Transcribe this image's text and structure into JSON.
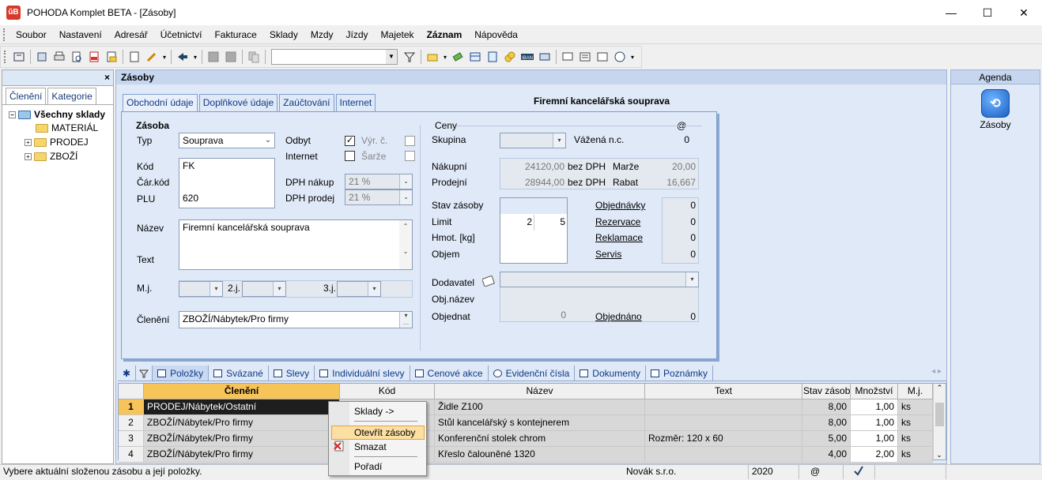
{
  "window": {
    "title": "POHODA Komplet BETA - [Zásoby]",
    "app_icon": "ŭB",
    "minimize": "—",
    "maximize": "☐",
    "close": "✕"
  },
  "menu": [
    "Soubor",
    "Nastavení",
    "Adresář",
    "Účetnictví",
    "Fakturace",
    "Sklady",
    "Mzdy",
    "Jízdy",
    "Majetek",
    "Záznam",
    "Nápověda"
  ],
  "left": {
    "close": "×",
    "tabs": [
      "Členění",
      "Kategorie"
    ],
    "tree": {
      "root": "Všechny sklady",
      "items": [
        "MATERIÁL",
        "PRODEJ",
        "ZBOŽÍ"
      ],
      "expand": "+",
      "collapse": "−"
    }
  },
  "main": {
    "title": "Zásoby",
    "tabs": [
      "Obchodní údaje",
      "Doplňkové údaje",
      "Zaúčtování",
      "Internet"
    ],
    "record_title": "Firemní kancelářská souprava"
  },
  "zasoba": {
    "title": "Zásoba",
    "typ_label": "Typ",
    "typ_value": "Souprava",
    "odbyt_label": "Odbyt",
    "internet_label": "Internet",
    "vyr_c_label": "Výr. č.",
    "sarze_label": "Šarže",
    "kod_label": "Kód",
    "kod_value": "FK",
    "car_kod_label": "Čár.kód",
    "plu_label": "PLU",
    "plu_value": "620",
    "dph_nakup_label": "DPH nákup",
    "dph_nakup_value": "21 %",
    "dph_prodej_label": "DPH prodej",
    "dph_prodej_value": "21 %",
    "nazev_label": "Název",
    "nazev_value": "Firemní kancelářská souprava",
    "text_label": "Text",
    "mj_label": "M.j.",
    "j2_label": "2.j.",
    "j3_label": "3.j.",
    "cleneni_label": "Členění",
    "cleneni_value": "ZBOŽÍ/Nábytek/Pro firmy"
  },
  "ceny": {
    "title": "Ceny",
    "at": "@",
    "skupina_label": "Skupina",
    "vazena_label": "Vážená n.c.",
    "vazena_value": "0",
    "nakupni_label": "Nákupní",
    "nakupni_value": "24120,00",
    "nakupni_unit": "bez DPH",
    "marze_label": "Marže",
    "marze_value": "20,00",
    "prodejni_label": "Prodejní",
    "prodejni_value": "28944,00",
    "prodejni_unit": "bez DPH",
    "rabat_label": "Rabat",
    "rabat_value": "16,667",
    "stav_label": "Stav zásoby",
    "limit_label": "Limit",
    "limit_min": "2",
    "limit_max": "5",
    "hmot_label": "Hmot. [kg]",
    "objem_label": "Objem",
    "objednavky": "Objednávky",
    "objednavky_val": "0",
    "rezervace": "Rezervace",
    "rezervace_val": "0",
    "reklamace": "Reklamace",
    "reklamace_val": "0",
    "servis": "Servis",
    "servis_val": "0",
    "dodavatel_label": "Dodavatel",
    "objnazev_label": "Obj.název",
    "objednat_label": "Objednat",
    "objednat_value": "0",
    "objednano": "Objednáno",
    "objednano_val": "0"
  },
  "bottom_tabs": {
    "star": "✱",
    "items": [
      "Položky",
      "Svázané",
      "Slevy",
      "Individuální slevy",
      "Cenové akce",
      "Evidenční čísla",
      "Dokumenty",
      "Poznámky"
    ]
  },
  "grid": {
    "headers": [
      "Členění",
      "Kód",
      "Název",
      "Text",
      "Stav zásoby",
      "Množství",
      "M.j."
    ],
    "rows": [
      {
        "n": "1",
        "cleneni": "PRODEJ/Nábytek/Ostatní",
        "kod": "",
        "nazev": "Židle Z100",
        "text": "",
        "stav": "8,00",
        "mnozstvi": "1,00",
        "mj": "ks"
      },
      {
        "n": "2",
        "cleneni": "ZBOŽÍ/Nábytek/Pro firmy",
        "kod": "",
        "nazev": "Stůl kancelářský s kontejnerem",
        "text": "",
        "stav": "8,00",
        "mnozstvi": "1,00",
        "mj": "ks"
      },
      {
        "n": "3",
        "cleneni": "ZBOŽÍ/Nábytek/Pro firmy",
        "kod": "",
        "nazev": "Konferenční stolek chrom",
        "text": "Rozměr: 120 x 60",
        "stav": "5,00",
        "mnozstvi": "1,00",
        "mj": "ks"
      },
      {
        "n": "4",
        "cleneni": "ZBOŽÍ/Nábytek/Pro firmy",
        "kod": "",
        "nazev": "Křeslo čalouněné 1320",
        "text": "",
        "stav": "4,00",
        "mnozstvi": "2,00",
        "mj": "ks"
      }
    ]
  },
  "context_menu": [
    "Sklady ->",
    "Otevřít zásoby",
    "Smazat",
    "Pořadí"
  ],
  "right": {
    "title": "Agenda",
    "item": "Zásoby"
  },
  "status": {
    "hint": "Vybere aktuální složenou zásobu a její položky.",
    "company": "Novák s.r.o.",
    "year": "2020",
    "at": "@"
  }
}
